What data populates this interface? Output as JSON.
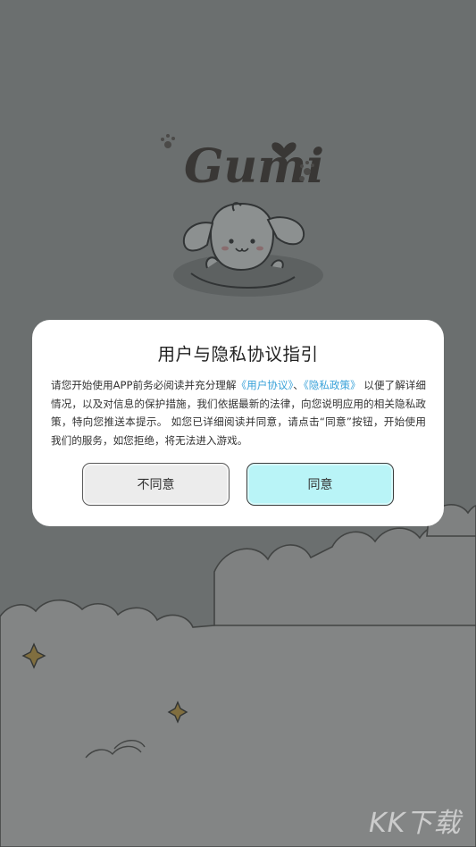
{
  "app": {
    "logo_text": "Gumi"
  },
  "dialog": {
    "title": "用户与隐私协议指引",
    "body_part1": "请您开始使用APP前务必阅读并充分理解",
    "user_agreement_link": "《用户协议》",
    "separator": "、",
    "privacy_policy_link": "《隐私政策》",
    "body_part2": "以便了解详细情况，以及对信息的保护措施，我们依据最新的法律，向您说明应用的相关隐私政策，特向您推送本提示。 如您已详细阅读并同意，请点击“同意”按钮，开始使用我们的服务，如您拒绝，将无法进入游戏。",
    "disagree_label": "不同意",
    "agree_label": "同意"
  },
  "watermark": {
    "text": "KK下载"
  },
  "colors": {
    "link": "#3aa2d9",
    "agree_button": "#b9f4f7",
    "disagree_button": "#ececec",
    "overlay": "#7b7f80"
  },
  "icons": {
    "mascot": "puppy-mascot-icon",
    "heart": "heart-icon",
    "paw": "paw-print-icon",
    "sparkle": "sparkle-star-icon"
  }
}
